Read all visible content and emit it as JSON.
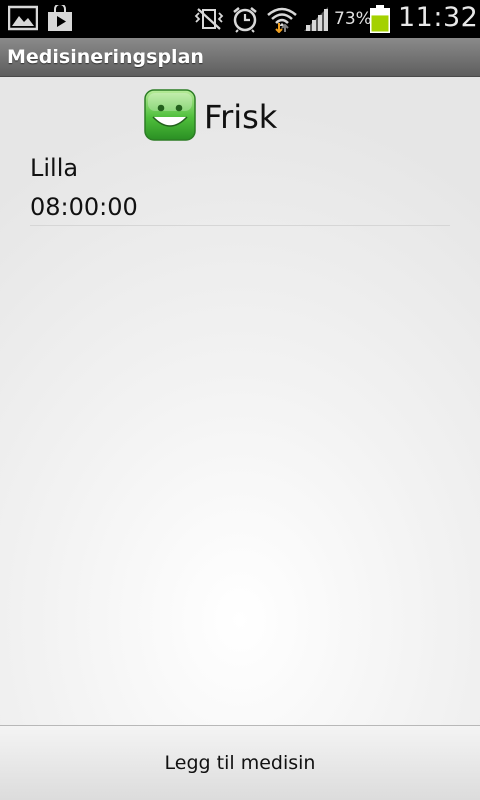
{
  "status_bar": {
    "left_icons": [
      "image-notification-icon",
      "play-store-notification-icon"
    ],
    "right_icons": [
      "vibrate-mute-icon",
      "alarm-clock-icon",
      "wifi-icon",
      "signal-icon",
      "battery-icon"
    ],
    "battery_percent": "73%",
    "battery_level": 0.73,
    "time": "11:32",
    "battery_color": "#a4d100"
  },
  "app_bar": {
    "title": "Medisineringsplan"
  },
  "health_status": {
    "icon": "happy-smiley-icon",
    "label": "Frisk",
    "color": "#3aa33a"
  },
  "medications": [
    {
      "name": "Lilla",
      "time": "08:00:00"
    }
  ],
  "actions": {
    "add_medicine_label": "Legg til medisin"
  }
}
